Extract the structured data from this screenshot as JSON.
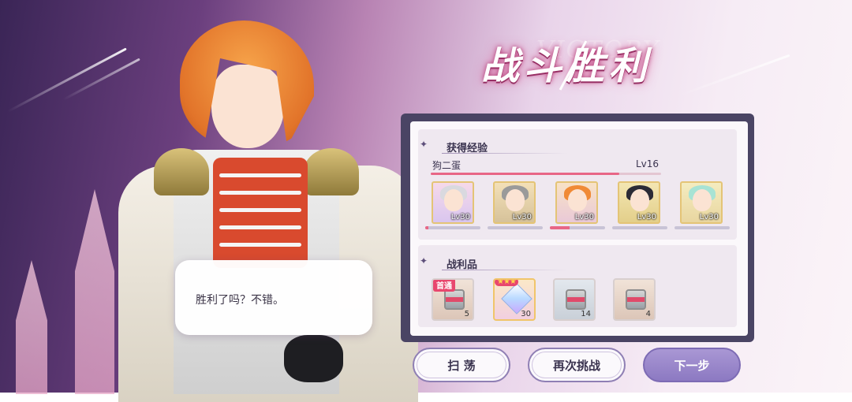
{
  "victory": {
    "title": "战斗胜利",
    "watermark": "VICTORY"
  },
  "dialogue": {
    "text": "胜利了吗？不错。"
  },
  "exp_section": {
    "title": "获得经验",
    "player": {
      "name": "狗二蛋",
      "level": "Lv16",
      "exp_progress": 0.82
    },
    "characters": [
      {
        "level": "Lv30",
        "hair_color": "#d9d9df",
        "exp_progress": 0.05
      },
      {
        "level": "Lv30",
        "hair_color": "#9a9a9a",
        "exp_progress": 0.0
      },
      {
        "level": "Lv30",
        "hair_color": "#f08a36",
        "exp_progress": 0.35
      },
      {
        "level": "Lv30",
        "hair_color": "#2b2b36",
        "exp_progress": 0.0
      },
      {
        "level": "Lv30",
        "hair_color": "#a8e3d4",
        "exp_progress": 0.0
      }
    ]
  },
  "loot_section": {
    "title": "战利品",
    "items": [
      {
        "count": "5",
        "badge": "首通",
        "icon": "food-can-icon"
      },
      {
        "count": "30",
        "badge_stars": "★★★",
        "icon": "diamond-icon"
      },
      {
        "count": "14",
        "icon": "food-can-icon"
      },
      {
        "count": "4",
        "icon": "food-can-icon"
      }
    ]
  },
  "buttons": {
    "sweep": "扫 荡",
    "retry": "再次挑战",
    "next": "下一步"
  },
  "colors": {
    "accent": "#e86686",
    "panel_frame": "#4a4464",
    "primary_button": "#9a87cc"
  }
}
